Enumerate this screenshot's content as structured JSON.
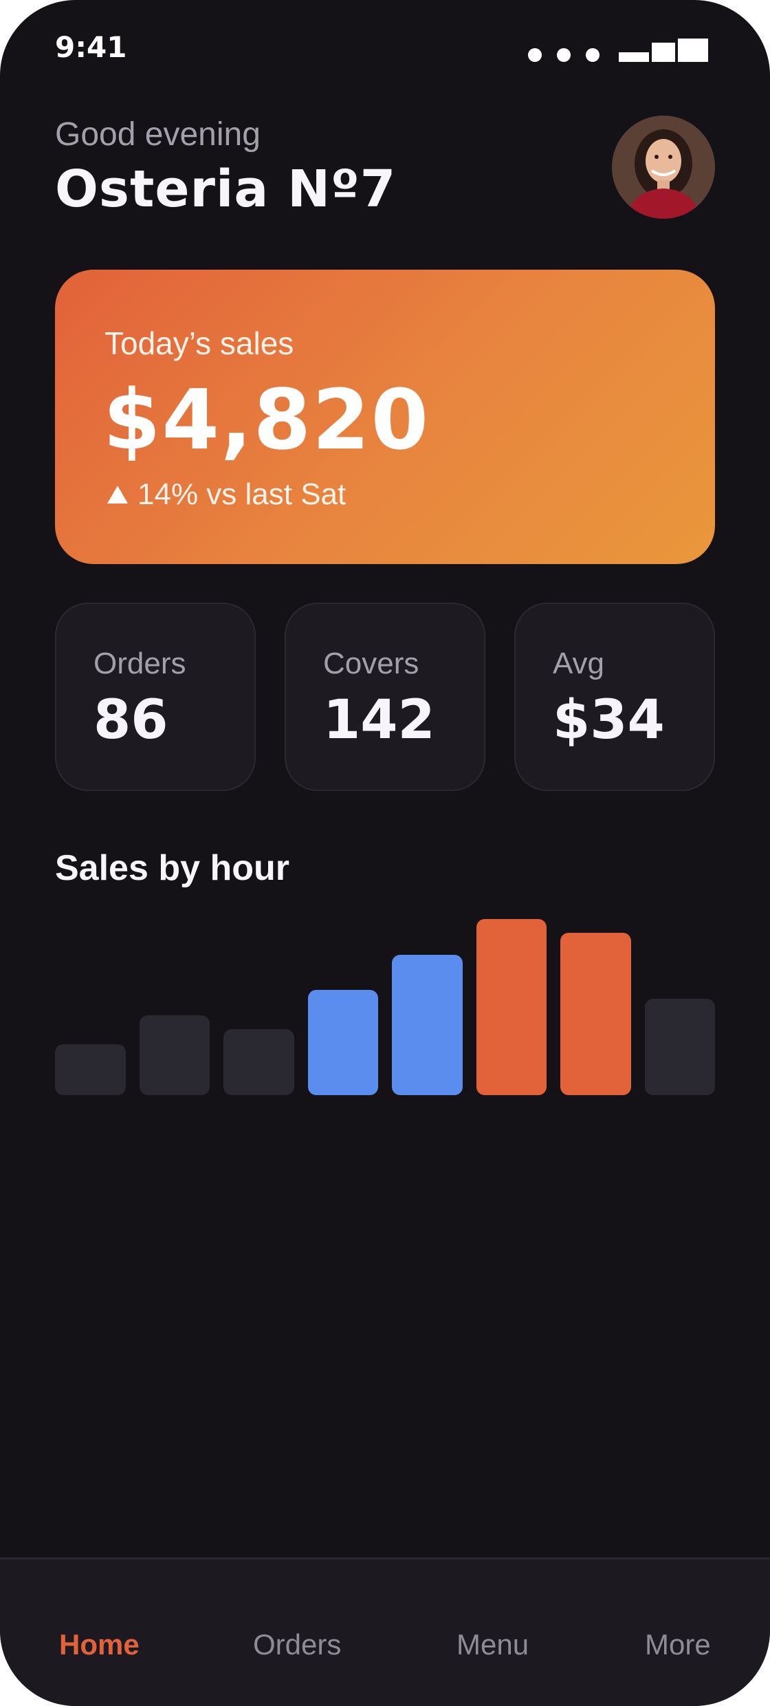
{
  "status_bar": {
    "time": "9:41",
    "icons": [
      "signal-dots-icon",
      "battery-icon"
    ]
  },
  "header": {
    "greeting": "Good evening",
    "venue_name": "Osteria Nº7",
    "avatar": "user-avatar"
  },
  "hero_card": {
    "label": "Today’s sales",
    "value": "$4,820",
    "change_icon": "triangle-up-icon",
    "change_text": "14% vs last Sat",
    "gradient": [
      "#e2623a",
      "#e9973c"
    ]
  },
  "stats": [
    {
      "label": "Orders",
      "value": "86"
    },
    {
      "label": "Covers",
      "value": "142"
    },
    {
      "label": "Avg",
      "value": "$34"
    }
  ],
  "chart_title": "Sales by hour",
  "chart_data": {
    "type": "bar",
    "title": "Sales by hour",
    "xlabel": "",
    "ylabel": "",
    "values": [
      30,
      47,
      39,
      62,
      83,
      104,
      96,
      57
    ],
    "colors": [
      "#2a2830",
      "#2a2830",
      "#2a2830",
      "#5b8def",
      "#5b8def",
      "#e2623a",
      "#e2623a",
      "#2a2830"
    ],
    "ylim": [
      0,
      104
    ],
    "grid": false
  },
  "nav": {
    "items": [
      {
        "label": "Home",
        "active": true
      },
      {
        "label": "Orders",
        "active": false
      },
      {
        "label": "Menu",
        "active": false
      },
      {
        "label": "More",
        "active": false
      }
    ],
    "active_color": "#e2623a"
  }
}
